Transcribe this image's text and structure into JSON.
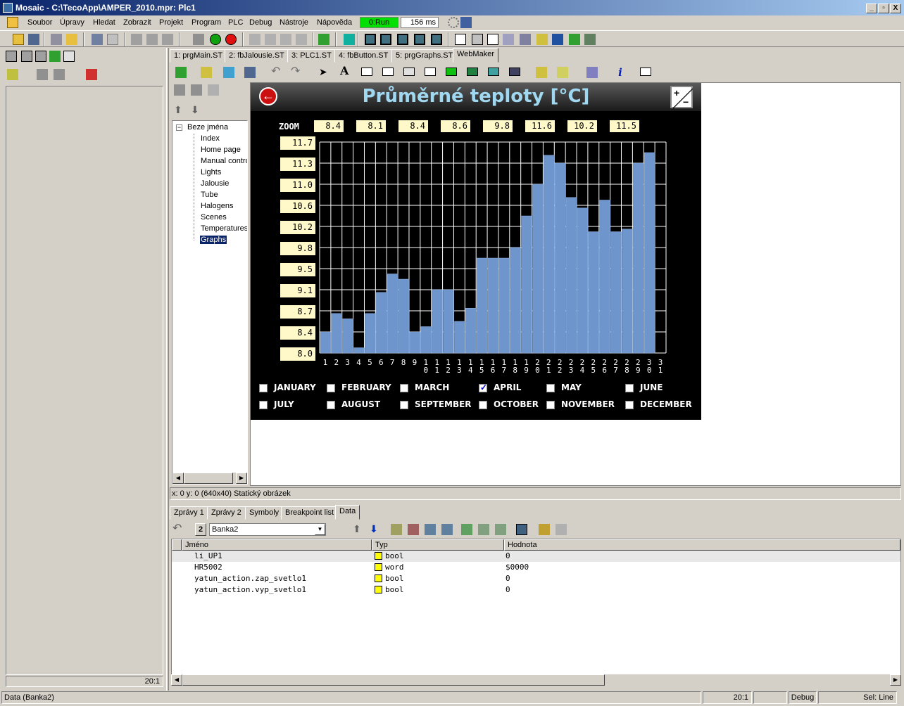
{
  "window": {
    "title": "Mosaic - C:\\TecoApp\\AMPER_2010.mpr: Plc1",
    "min": "_",
    "max": "▫",
    "close": "X"
  },
  "menu": [
    "Soubor",
    "Úpravy",
    "Hledat",
    "Zobrazit",
    "Projekt",
    "Program",
    "PLC",
    "Debug",
    "Nástroje",
    "Nápověda"
  ],
  "run_status": "0:Run",
  "cycle_time": "156 ms",
  "editor_tabs": [
    "1: prgMain.ST",
    "2: fbJalousie.ST",
    "3: PLC1.ST",
    "4: fbButton.ST",
    "5: prgGraphs.ST",
    "WebMaker"
  ],
  "tree": {
    "root": "Beze jména",
    "items": [
      "Index",
      "Home page",
      "Manual contro",
      "Lights",
      "Jalousie",
      "Tube",
      "Halogens",
      "Scenes",
      "Temperatures",
      "Graphs"
    ],
    "selected": "Graphs"
  },
  "hmi": {
    "title": "Průměrné teploty [°C]",
    "zoom_label": "ZOOM",
    "zoom_values": [
      "8.4",
      "8.1",
      "8.4",
      "8.6",
      "9.8",
      "11.6",
      "10.2",
      "11.5"
    ],
    "y_labels": [
      "11.7",
      "11.3",
      "11.0",
      "10.6",
      "10.2",
      "9.8",
      "9.5",
      "9.1",
      "8.7",
      "8.4",
      "8.0"
    ],
    "months": [
      {
        "name": "JANUARY",
        "checked": false
      },
      {
        "name": "FEBRUARY",
        "checked": false
      },
      {
        "name": "MARCH",
        "checked": false
      },
      {
        "name": "APRIL",
        "checked": true
      },
      {
        "name": "MAY",
        "checked": false
      },
      {
        "name": "JUNE",
        "checked": false
      },
      {
        "name": "JULY",
        "checked": false
      },
      {
        "name": "AUGUST",
        "checked": false
      },
      {
        "name": "SEPTEMBER",
        "checked": false
      },
      {
        "name": "OCTOBER",
        "checked": false
      },
      {
        "name": "NOVEMBER",
        "checked": false
      },
      {
        "name": "DECEMBER",
        "checked": false
      }
    ],
    "bar_color": "#6e96cc"
  },
  "chart_data": {
    "type": "bar",
    "categories": [
      "1",
      "2",
      "3",
      "4",
      "5",
      "6",
      "7",
      "8",
      "9",
      "10",
      "11",
      "12",
      "13",
      "14",
      "15",
      "16",
      "17",
      "18",
      "19",
      "20",
      "21",
      "22",
      "23",
      "24",
      "25",
      "26",
      "27",
      "28",
      "29",
      "30",
      "31"
    ],
    "values": [
      8.4,
      8.75,
      8.65,
      8.1,
      8.75,
      9.15,
      9.5,
      9.4,
      8.4,
      8.5,
      9.2,
      9.2,
      8.6,
      8.85,
      9.8,
      9.8,
      9.8,
      10.0,
      10.6,
      11.2,
      11.75,
      11.6,
      10.95,
      10.75,
      10.3,
      10.9,
      10.3,
      10.35,
      11.6,
      11.8
    ],
    "ylim": [
      8.0,
      12.0
    ]
  },
  "status_line": "x: 0 y: 0 (640x40) Statický obrázek",
  "bottom_tabs": [
    "Zprávy 1",
    "Zprávy 2",
    "Symboly",
    "Breakpoint list",
    "Data"
  ],
  "data_panel": {
    "bank_num": "2",
    "bank": "Banka2",
    "columns": [
      "Jméno",
      "Typ",
      "Hodnota"
    ],
    "rows": [
      {
        "name": "li_UP1",
        "type": "bool",
        "value": "0"
      },
      {
        "name": "HR5002",
        "type": "word",
        "value": "$0000"
      },
      {
        "name": "yatun_action.zap_svetlo1",
        "type": "bool",
        "value": "0"
      },
      {
        "name": "yatun_action.vyp_svetlo1",
        "type": "bool",
        "value": "0"
      }
    ]
  },
  "left_status": "20:1",
  "statusbar": {
    "left": "Data (Banka2)",
    "pos": "20:1",
    "mode": "Debug",
    "sel": "Sel: Line"
  }
}
